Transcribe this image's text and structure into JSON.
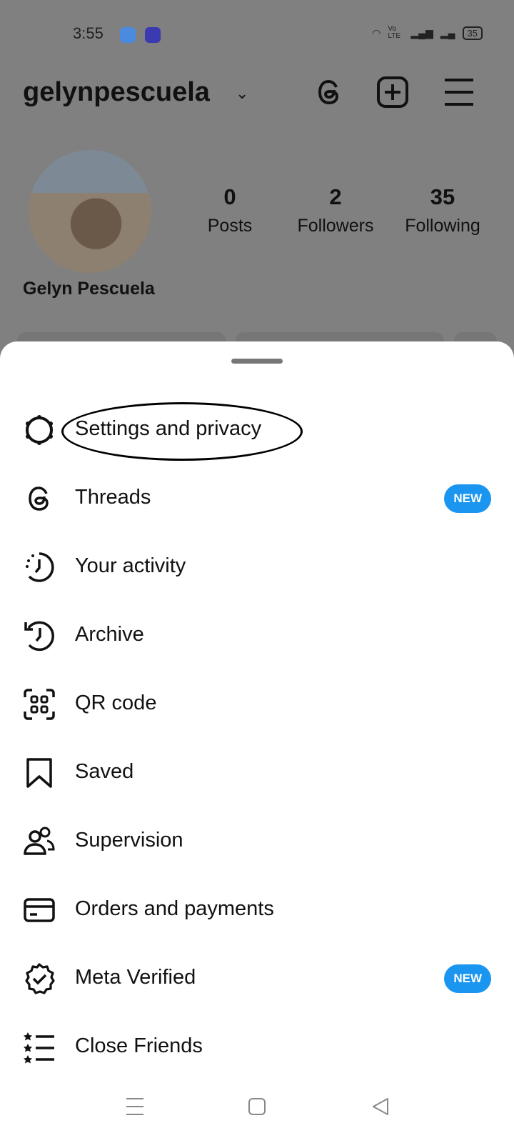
{
  "status_bar": {
    "time": "3:55",
    "battery": "35",
    "network_label": "Vo LTE"
  },
  "header": {
    "username": "gelynpescuela"
  },
  "profile": {
    "full_name": "Gelyn Pescuela",
    "stats": [
      {
        "value": "0",
        "label": "Posts"
      },
      {
        "value": "2",
        "label": "Followers"
      },
      {
        "value": "35",
        "label": "Following"
      }
    ]
  },
  "menu": {
    "items": [
      {
        "label": "Settings and privacy",
        "icon": "gear-icon",
        "highlighted": true
      },
      {
        "label": "Threads",
        "icon": "threads-icon",
        "badge": "NEW"
      },
      {
        "label": "Your activity",
        "icon": "activity-icon"
      },
      {
        "label": "Archive",
        "icon": "archive-icon"
      },
      {
        "label": "QR code",
        "icon": "qr-code-icon"
      },
      {
        "label": "Saved",
        "icon": "bookmark-icon"
      },
      {
        "label": "Supervision",
        "icon": "supervision-icon"
      },
      {
        "label": "Orders and payments",
        "icon": "card-icon"
      },
      {
        "label": "Meta Verified",
        "icon": "verified-icon",
        "badge": "NEW"
      },
      {
        "label": "Close Friends",
        "icon": "close-friends-icon"
      }
    ]
  },
  "colors": {
    "badge": "#1a95f0",
    "overlay": "#808080"
  }
}
